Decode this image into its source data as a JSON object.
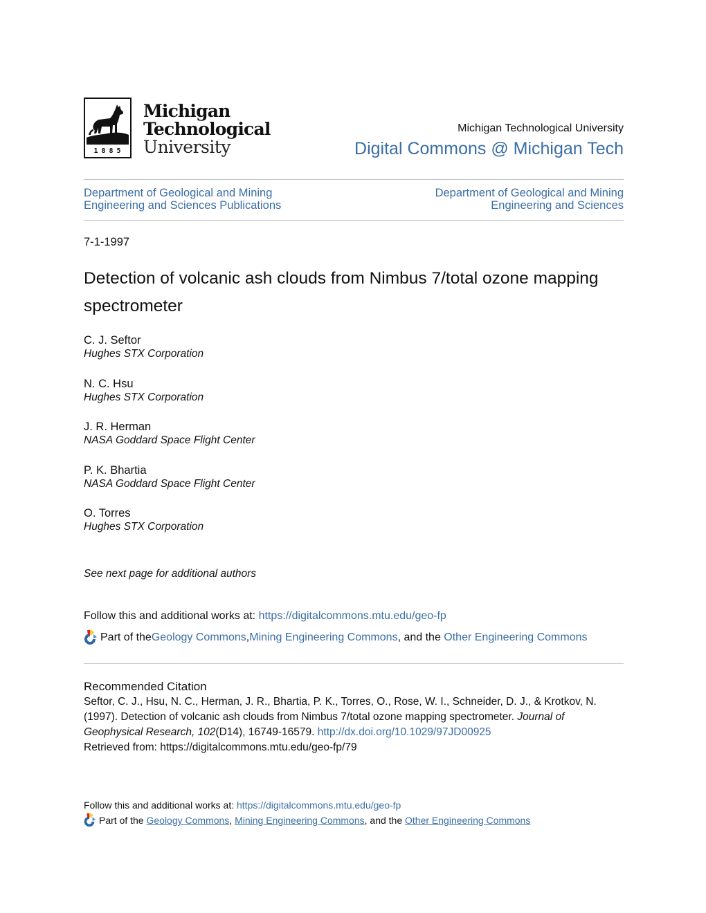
{
  "header": {
    "logo": {
      "line1": "Michigan",
      "line2": "Technological",
      "line3": "University",
      "year": "1885",
      "emblem": "husky-icon"
    },
    "institution": "Michigan Technological University",
    "repository": "Digital Commons @ Michigan Tech"
  },
  "departments": {
    "left": {
      "line1": "Department of Geological and Mining",
      "line2": "Engineering and Sciences Publications"
    },
    "right": {
      "line1": "Department of Geological and Mining",
      "line2": "Engineering and Sciences"
    }
  },
  "article": {
    "date": "7-1-1997",
    "title": "Detection of volcanic ash clouds from Nimbus 7/total ozone mapping spectrometer",
    "authors": [
      {
        "name": "C. J. Seftor",
        "affiliation": "Hughes STX Corporation"
      },
      {
        "name": "N. C. Hsu",
        "affiliation": "Hughes STX Corporation"
      },
      {
        "name": "J. R. Herman",
        "affiliation": "NASA Goddard Space Flight Center"
      },
      {
        "name": "P. K. Bhartia",
        "affiliation": "NASA Goddard Space Flight Center"
      },
      {
        "name": "O. Torres",
        "affiliation": "Hughes STX Corporation"
      }
    ],
    "more_authors": "See next page for additional authors"
  },
  "follow": {
    "prefix": "Follow this and additional works at: ",
    "url": "https://digitalcommons.mtu.edu/geo-fp"
  },
  "part_of": {
    "icon": "bepress-commons-icon",
    "prefix": "Part of the ",
    "link1": "Geology Commons",
    "sep1": ", ",
    "link2": "Mining Engineering Commons",
    "sep2": ", and the ",
    "link3": "Other Engineering Commons"
  },
  "citation": {
    "heading": "Recommended Citation",
    "authors_text": "Seftor, C. J., Hsu, N. C., Herman, J. R., Bhartia, P. K., Torres, O., Rose, W. I., Schneider, D. J., & Krotkov, N. (1997). Detection of volcanic ash clouds from Nimbus 7/total ozone mapping spectrometer. ",
    "journal": "Journal of Geophysical Research, 102",
    "issue_pages": "(D14), 16749-16579. ",
    "doi": "http://dx.doi.org/10.1029/97JD00925",
    "retrieved": "Retrieved from: https://digitalcommons.mtu.edu/geo-fp/79"
  },
  "colors": {
    "link": "#3a6ea5",
    "text": "#111111",
    "rule": "#c4c4c4"
  }
}
